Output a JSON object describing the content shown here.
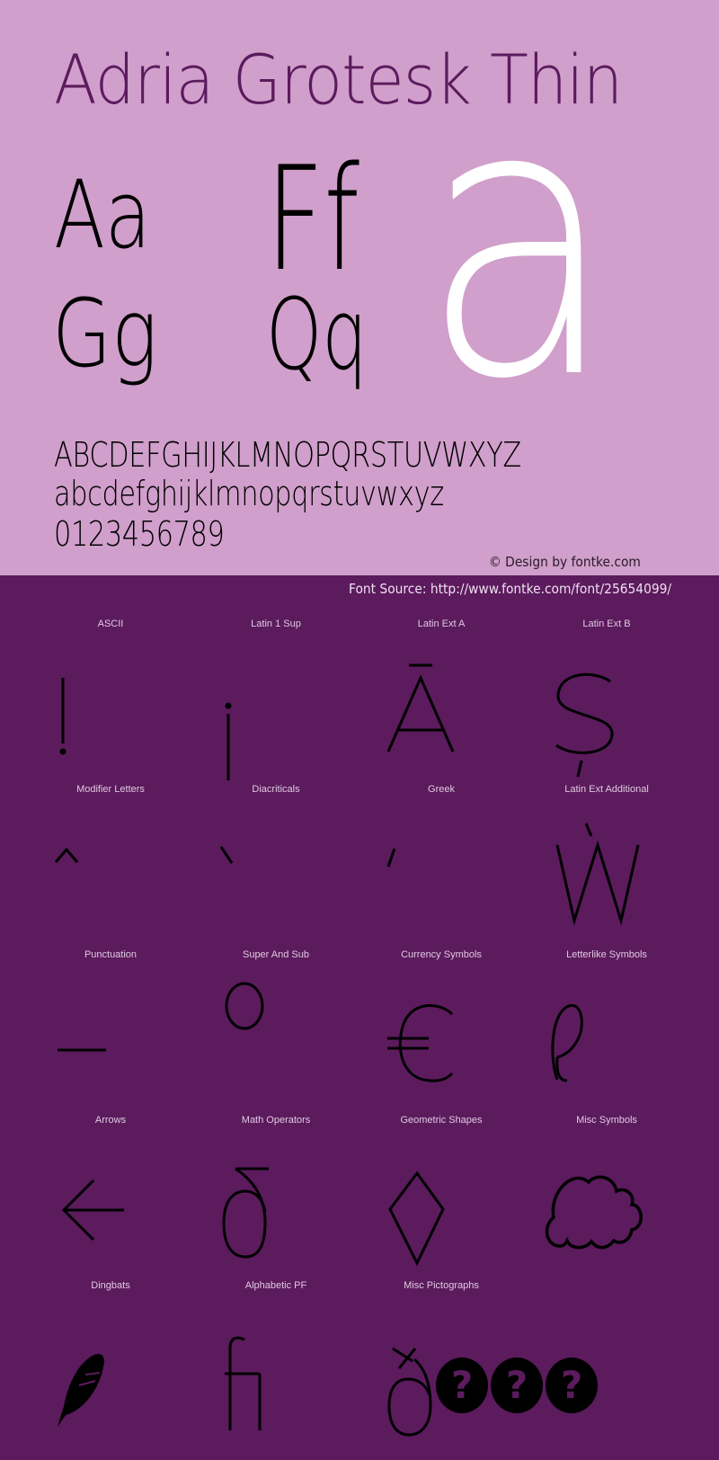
{
  "header": {
    "title": "Adria Grotesk Thin",
    "title_color": "#5b1b5d",
    "background_top": "#d09fcb",
    "background_bottom": "#5b1b5d"
  },
  "specimen": {
    "pairs": [
      "Aa",
      "Ff",
      "Gg",
      "Qq"
    ],
    "big_glyph": "a",
    "uppercase": "ABCDEFGHIJKLMNOPQRSTUVWXYZ",
    "lowercase": "abcdefghijklmnopqrstuvwxyz",
    "digits": "0123456789"
  },
  "credit": "© Design by fontke.com",
  "font_source": "Font Source: http://www.fontke.com/font/25654099/",
  "blocks": [
    {
      "label": "ASCII",
      "glyph": "!",
      "icon": "exclamation-glyph"
    },
    {
      "label": "Latin 1 Sup",
      "glyph": "¡",
      "icon": "inverted-exclamation-glyph"
    },
    {
      "label": "Latin Ext A",
      "glyph": "Ā",
      "icon": "a-macron-glyph"
    },
    {
      "label": "Latin Ext B",
      "glyph": "Ș",
      "icon": "s-comma-glyph"
    },
    {
      "label": "Modifier Letters",
      "glyph": "ˆ",
      "icon": "circumflex-glyph"
    },
    {
      "label": "Diacriticals",
      "glyph": "̀",
      "icon": "grave-accent-glyph"
    },
    {
      "label": "Greek",
      "glyph": "΄",
      "icon": "tonos-glyph"
    },
    {
      "label": "Latin Ext Additional",
      "glyph": "Ẁ",
      "icon": "w-grave-glyph"
    },
    {
      "label": "Punctuation",
      "glyph": "–",
      "icon": "en-dash-glyph"
    },
    {
      "label": "Super And Sub",
      "glyph": "⁰",
      "icon": "superscript-zero-glyph"
    },
    {
      "label": "Currency Symbols",
      "glyph": "€",
      "icon": "euro-glyph"
    },
    {
      "label": "Letterlike Symbols",
      "glyph": "ℓ",
      "icon": "script-l-glyph"
    },
    {
      "label": "Arrows",
      "glyph": "←",
      "icon": "left-arrow-glyph"
    },
    {
      "label": "Math Operators",
      "glyph": "∂",
      "icon": "partial-differential-glyph"
    },
    {
      "label": "Geometric Shapes",
      "glyph": "◊",
      "icon": "lozenge-glyph"
    },
    {
      "label": "Misc Symbols",
      "glyph": "☁",
      "icon": "cloud-glyph"
    },
    {
      "label": "Dingbats",
      "glyph": "✒",
      "icon": "feather-glyph"
    },
    {
      "label": "Alphabetic PF",
      "glyph": "ﬁ",
      "icon": "fi-ligature-glyph"
    },
    {
      "label": "Misc Pictographs",
      "glyph": "ð???",
      "icon": "missing-glyphs"
    }
  ]
}
